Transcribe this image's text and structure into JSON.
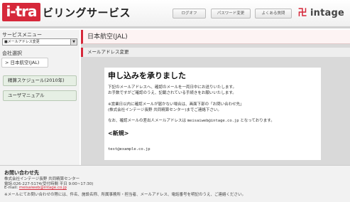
{
  "header": {
    "logo_box": "i-tra",
    "logo_text": "ビリングサービス",
    "buttons": [
      "ログオフ",
      "パスワード変更",
      "よくある質問"
    ],
    "brand_mark": "卍",
    "brand_name": "intage"
  },
  "sidebar": {
    "menu_title": "サービスメニュー",
    "menu_select_value": "■メールアドレス変更",
    "section_label": "会社選択",
    "company_button": "> 日本航空(JAL)",
    "buttons": [
      "精算スケジュール(2010年)",
      "ユーザマニュアル"
    ]
  },
  "main": {
    "title": "日本航空(JAL)",
    "subtitle": "メールアドレス変更",
    "panel": {
      "heading": "申し込みを承りました",
      "line1": "下記のメールアドレスへ、確認のメールを一両日中にお送りいたします。",
      "line2": "お手数ですがご確認のうえ、記載されている手続きをお願いいたします。",
      "line3": "※営業日以内に確認メールが届かない場合は、画面下部の「お問い合わせ先」",
      "line4": "(株式会社インテージ長野 共同精算センター)までご連絡下さい。",
      "line5_prefix": "なお、確認メールの差出人メールアドレスは ",
      "line5_email": "meisaiweb@intage.co.jp",
      "line5_suffix": " となっております。",
      "new_label": "<新規>",
      "email": "test@example.co.jp"
    }
  },
  "footer": {
    "title": "お問い合わせ先",
    "line1": "株式会社インテージ長野 共同精算センター",
    "line2": "電話:026-227-5174(受付時間 平日 9:00~17:30)",
    "line3_prefix": "E-mail: ",
    "line3_email": "meisaiweb@intage.co.jp",
    "line4": "※メールにてお問い合わせの際には、件名、施設名称、所属事務所・担当者、メールアドレス、電話番号を明記のうえ、ご連絡ください。"
  },
  "colors": {
    "accent": "#d6283a",
    "main_bg": "#d9d9d9",
    "sidebar_bg": "#f2f2f2",
    "side_button_bg": "#e6efe4"
  }
}
